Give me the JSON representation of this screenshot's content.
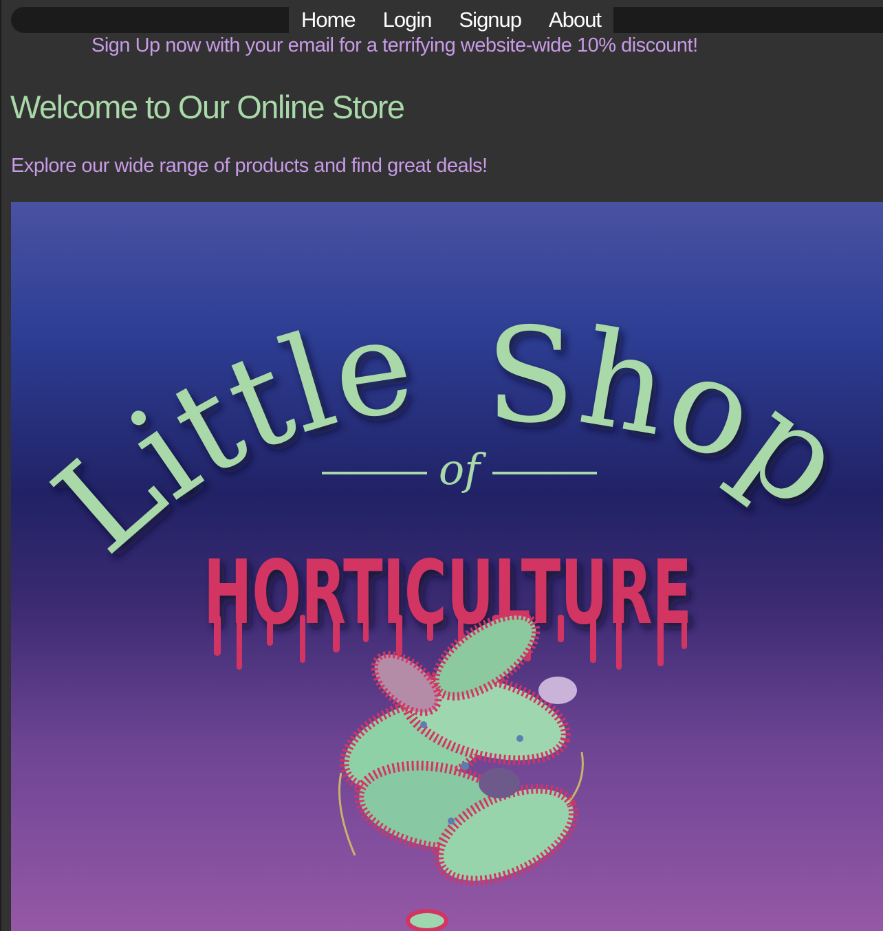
{
  "nav": {
    "items": [
      {
        "label": "Home"
      },
      {
        "label": "Login"
      },
      {
        "label": "Signup"
      },
      {
        "label": "About"
      }
    ]
  },
  "promo": {
    "text": "Sign Up now with your email for a terrifying website-wide 10% discount!"
  },
  "main": {
    "title": "Welcome to Our Online Store",
    "subtitle": "Explore our wide range of products and find great deals!"
  },
  "banner": {
    "logo_line1a": "Little",
    "logo_line1b": "Shop",
    "logo_of": "of",
    "logo_line2": "HORTICULTURE",
    "image": "venus-flytrap-illustration"
  },
  "colors": {
    "background": "#323232",
    "navbar": "#1b1b1b",
    "accent_purple": "#c89be6",
    "accent_green": "#a9d9a9",
    "logo_pink": "#d33563"
  }
}
